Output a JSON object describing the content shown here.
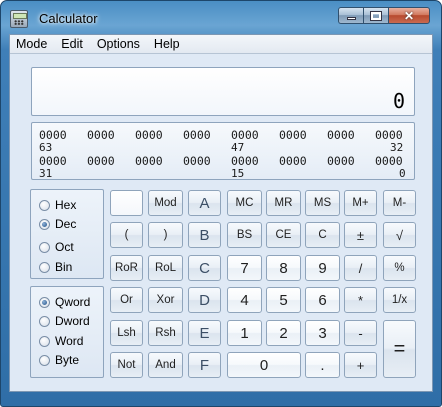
{
  "window": {
    "title": "Calculator"
  },
  "menu": [
    "Mode",
    "Edit",
    "Options",
    "Help"
  ],
  "display": {
    "value": "0"
  },
  "bits": {
    "row1": [
      "0000",
      "0000",
      "0000",
      "0000",
      "0000",
      "0000",
      "0000",
      "0000"
    ],
    "row1_positions": [
      "63",
      "47",
      "32"
    ],
    "row2": [
      "0000",
      "0000",
      "0000",
      "0000",
      "0000",
      "0000",
      "0000",
      "0000"
    ],
    "row2_positions": [
      "31",
      "15",
      "0"
    ]
  },
  "base": {
    "options": [
      "Hex",
      "Dec",
      "Oct",
      "Bin"
    ],
    "selected": "Dec"
  },
  "word": {
    "options": [
      "Qword",
      "Dword",
      "Word",
      "Byte"
    ],
    "selected": "Qword"
  },
  "keys": {
    "mod": "Mod",
    "a": "A",
    "mc": "MC",
    "mr": "MR",
    "ms": "MS",
    "mplus": "M+",
    "mminus": "M-",
    "lparen": "(",
    "rparen": ")",
    "b": "B",
    "bs": "BS",
    "ce": "CE",
    "c": "C",
    "plusminus": "±",
    "sqrt": "√",
    "ror": "RoR",
    "rol": "RoL",
    "hc": "C",
    "n7": "7",
    "n8": "8",
    "n9": "9",
    "div": "/",
    "pct": "%",
    "or": "Or",
    "xor": "Xor",
    "d": "D",
    "n4": "4",
    "n5": "5",
    "n6": "6",
    "mul": "*",
    "recip": "1/x",
    "lsh": "Lsh",
    "rsh": "Rsh",
    "e": "E",
    "n1": "1",
    "n2": "2",
    "n3": "3",
    "minus": "-",
    "eq": "=",
    "not": "Not",
    "and": "And",
    "f": "F",
    "n0": "0",
    "dot": ".",
    "plus": "+"
  }
}
